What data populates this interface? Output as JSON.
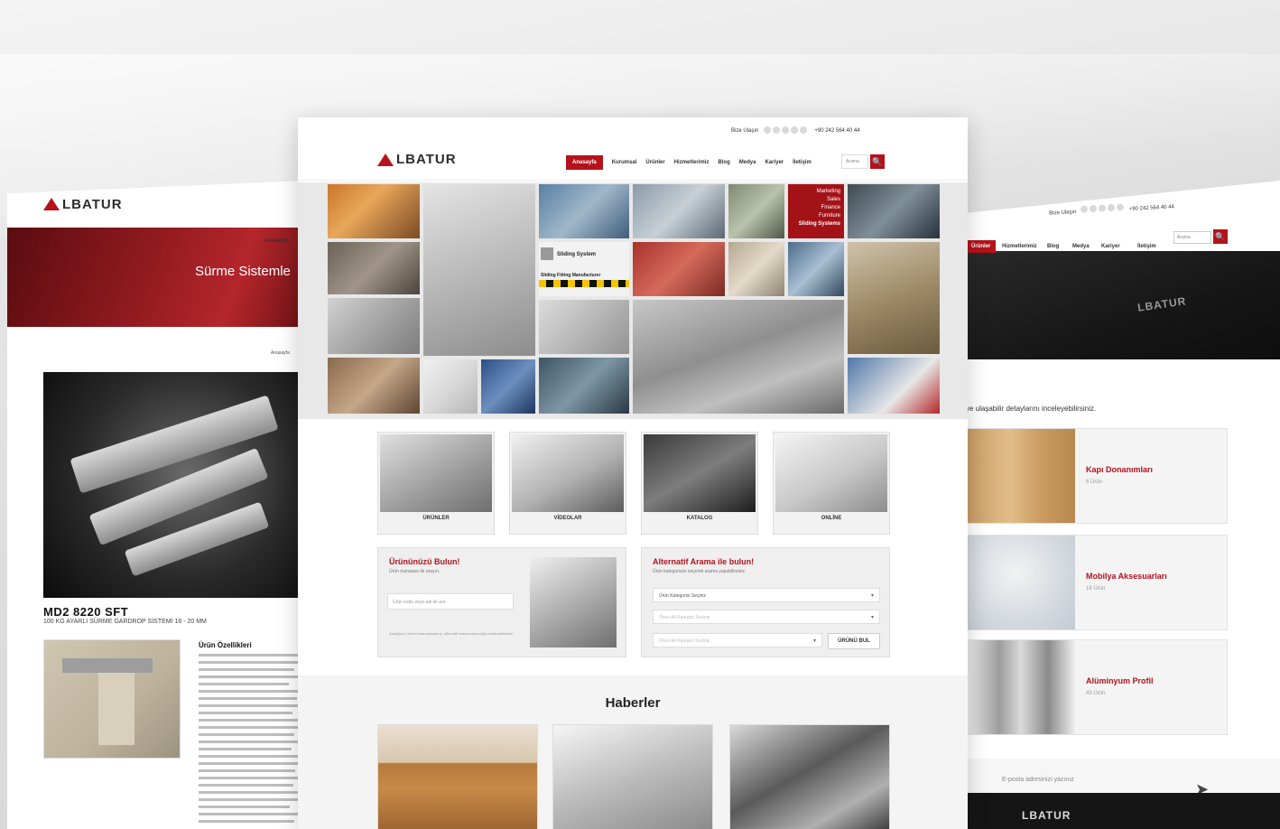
{
  "left_page": {
    "logo": "LBATUR",
    "nav_item": "Anasayfa",
    "hero_title": "Sürme Sistemle",
    "breadcrumb": "Anasayfa",
    "product_code": "MD2 8220 SFT",
    "product_subtitle": "100 KG AYARLI SÜRME GARDROP SİSTEMİ 16 - 20 MM",
    "features_title": "Ürün Özellikleri"
  },
  "center_page": {
    "topbar": {
      "location": "Bize Ulaşın",
      "phone": "+90 242 564 40 44"
    },
    "logo": "LBATUR",
    "nav": [
      "Anasayfa",
      "Kurumsal",
      "Ürünler",
      "Hizmetlerimiz",
      "Blog",
      "Medya",
      "Kariyer",
      "İletişim"
    ],
    "search_placeholder": "Arama",
    "search_icon": "🔍",
    "mosaic": {
      "red_tile_lines": [
        "Marketing",
        "Sales",
        "Finance",
        "Furniture",
        "Sliding Systems"
      ],
      "sliding_label": "Sliding System",
      "manufacturer_label": "Sliding Fitting Manufacturer"
    },
    "quick_buttons": [
      "ÜRÜNLER",
      "VİDEOLAR",
      "KATALOG",
      "ONLİNE"
    ],
    "find_product": {
      "title": "Ürününüzü Bulun!",
      "subtitle": "Ürün numarası ile arayın.",
      "input_placeholder": "Ürün kodu veya adı ile ara",
      "note": "Aradığınız ürünü bulamadıysanız, alternatif arama seçeneğini kullanabilirsiniz."
    },
    "alt_search": {
      "title": "Alternatif Arama ile bulun!",
      "subtitle": "Ürün kategorisini seçerek arama yapabilirsiniz.",
      "select1": "Ürün Kategorisi Seçiniz",
      "select2": "Önce Alt Kategori Seçiniz",
      "select3": "Önce Alt Kategori Seçiniz",
      "button": "ÜRÜNÜ BUL"
    },
    "news_title": "Haberler"
  },
  "right_page": {
    "top_location": "Bize Ulaşın",
    "top_phone": "+90 242 564 40 44",
    "nav": [
      "Ürünler",
      "Hizmetlerimiz",
      "Blog",
      "Medya",
      "Kariyer",
      "İletişim"
    ],
    "search_placeholder": "Arama",
    "search_icon": "🔍",
    "hero_logo": "LBATUR",
    "lead_text": "ve ulaşabilir detaylarını inceleyebilirsiniz.",
    "categories": [
      {
        "name": "Kapı Donanımları",
        "count": "6 Ürün"
      },
      {
        "name": "Mobilya Aksesuarları",
        "count": "18 Ürün"
      },
      {
        "name": "Alüminyum Profil",
        "count": "43 Ürün"
      }
    ],
    "newsletter_placeholder": "E-posta adresinizi yazınız",
    "send_icon": "➤",
    "footer_logo": "LBATUR"
  }
}
